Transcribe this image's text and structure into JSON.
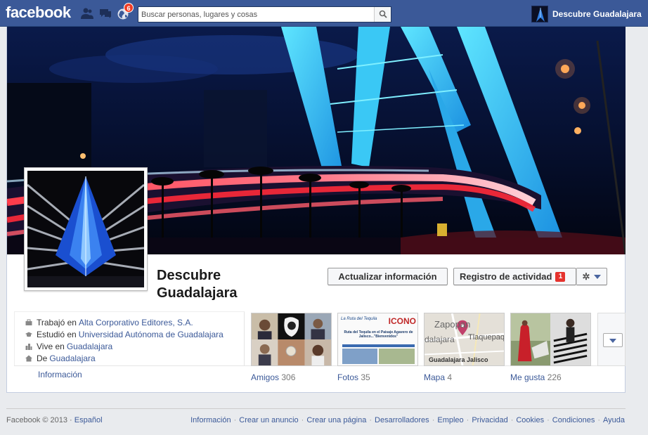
{
  "topbar": {
    "logo": "facebook",
    "notifications_count": "6",
    "search_placeholder": "Buscar personas, lugares y cosas",
    "profile_name": "Descubre Guadalajara"
  },
  "profile": {
    "name_line1": "Descubre",
    "name_line2": "Guadalajara",
    "update_button": "Actualizar información",
    "activity_button": "Registro de actividad",
    "activity_count": "1"
  },
  "about": {
    "rows": [
      {
        "prefix": "Trabajó en",
        "link": "Alta Corporativo Editores, S.A."
      },
      {
        "prefix": "Estudió en",
        "link": "Universidad Autónoma de Guadalajara"
      },
      {
        "prefix": "Vive en",
        "link": "Guadalajara"
      },
      {
        "prefix": "De",
        "link": "Guadalajara"
      }
    ],
    "info_link": "Información"
  },
  "tiles": {
    "friends": {
      "label": "Amigos",
      "count": "306"
    },
    "photos": {
      "label": "Fotos",
      "count": "35",
      "banner_text": "ICONO",
      "caption": "Ruta del Tequila en el Paisaje Agavero de Jalisco...\"Bienvenidos\"",
      "header": "La Ruta del Tequila"
    },
    "map": {
      "label": "Mapa",
      "count": "4",
      "city1": "Zapopan",
      "city2": "Tlaquepaq",
      "city3": "dalajara",
      "caption": "Guadalajara Jalisco"
    },
    "likes": {
      "label": "Me gusta",
      "count": "226"
    }
  },
  "footer": {
    "copyright": "Facebook © 2013 ·",
    "language": "Español",
    "links": [
      "Información",
      "Crear un anuncio",
      "Crear una página",
      "Desarrolladores",
      "Empleo",
      "Privacidad",
      "Cookies",
      "Condiciones",
      "Ayuda"
    ]
  },
  "colors": {
    "brand_blue": "#3b5998",
    "link_blue": "#3b5998",
    "badge_red": "#f03d25"
  }
}
